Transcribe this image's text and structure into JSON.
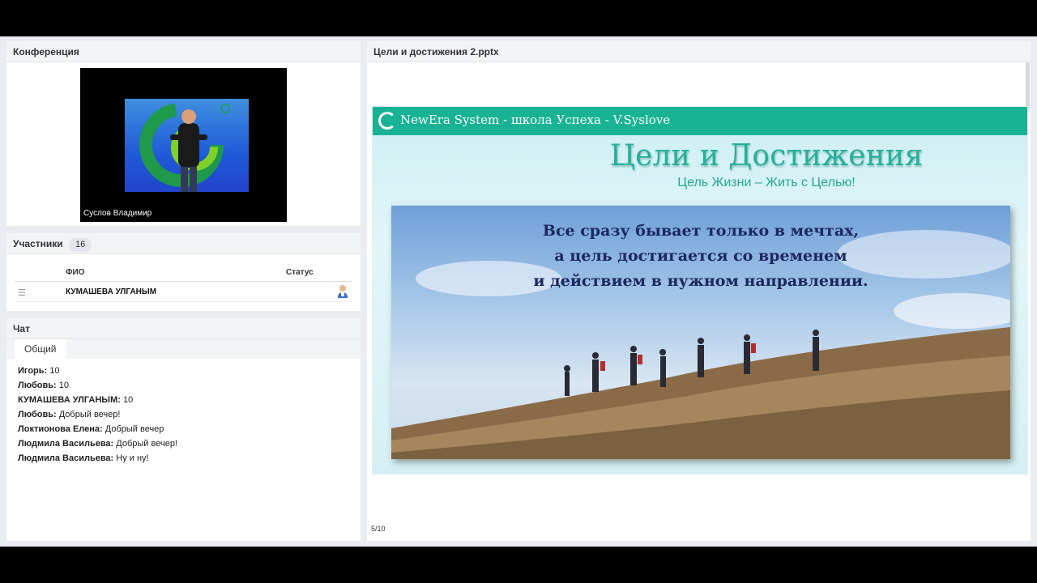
{
  "conference": {
    "title": "Конференция",
    "speaker_name": "Суслов Владимир"
  },
  "participants": {
    "title": "Участники",
    "count": "16",
    "col_name": "ФИО",
    "col_status": "Статус",
    "rows": [
      {
        "name": "КУМАШЕВА УЛГАНЫМ",
        "status_icon": "user-icon"
      }
    ]
  },
  "chat": {
    "title": "Чат",
    "active_tab": "Общий",
    "messages": [
      {
        "author": "Игорь:",
        "text": "10"
      },
      {
        "author": "Любовь:",
        "text": "10"
      },
      {
        "author": "КУМАШЕВА УЛГАНЫМ:",
        "text": "10"
      },
      {
        "author": "Любовь:",
        "text": "Добрый вечер!"
      },
      {
        "author": "Локтионова Елена:",
        "text": "Добрый вечер"
      },
      {
        "author": "Людмила Васильева:",
        "text": "Добрый вечер!"
      },
      {
        "author": "Людмила Васильева:",
        "text": "Ну и ну!"
      }
    ]
  },
  "presentation": {
    "title": "Цели и достижения 2.pptx",
    "page": "5/10",
    "slide": {
      "bar_text": "NewEra System - школа Успеха - V.Syslove",
      "heading": "Цели и Достижения",
      "subheading": "Цель Жизни – Жить с Целью!",
      "quote_lines": [
        "Все сразу бывает только в мечтах,",
        "а цель достигается со временем",
        "и действием в нужном направлении."
      ],
      "colors": {
        "bar": "#17b394",
        "heading": "#25b09b",
        "quote": "#1d2760"
      }
    }
  }
}
